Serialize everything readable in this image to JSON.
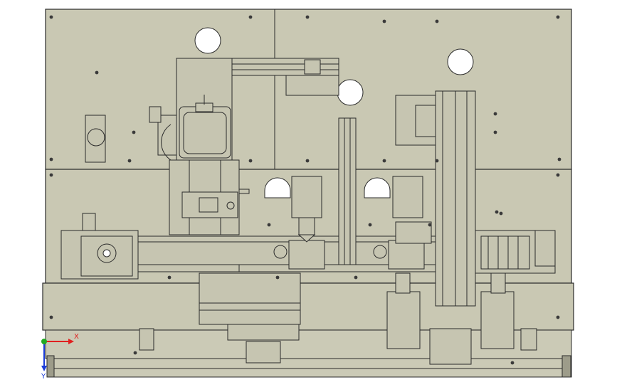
{
  "triad": {
    "x_label": "X",
    "y_label": "Y",
    "x_color": "#e02020",
    "y_color": "#1a3bd8",
    "origin_color": "#22aa22"
  },
  "colors": {
    "plate": "#c9c8b3",
    "line": "#2b2b2b",
    "background": "#ffffff"
  }
}
